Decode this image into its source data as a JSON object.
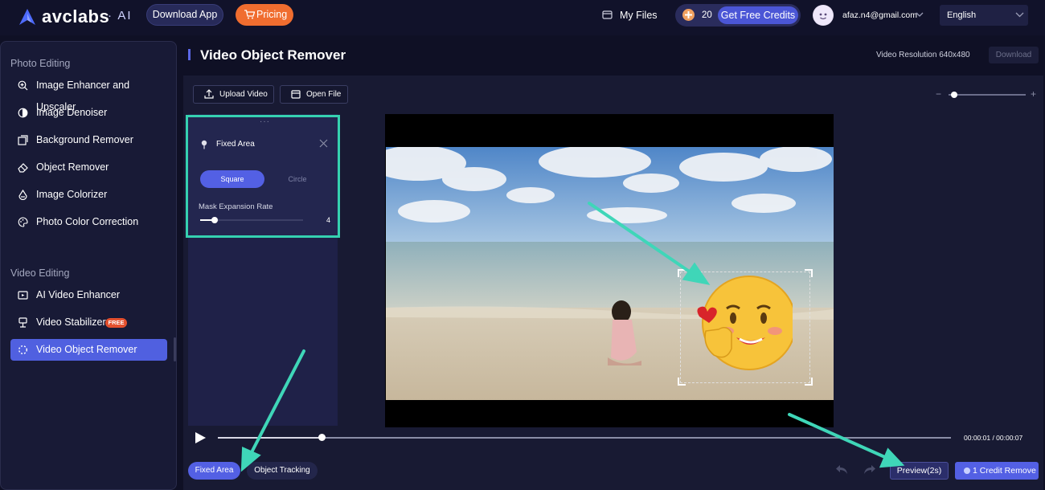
{
  "brand": {
    "name": "avclabs",
    "suffix": "· AI"
  },
  "topbar": {
    "download_app": "Download App",
    "pricing": "Pricing",
    "my_files": "My Files",
    "credits": "20",
    "get_free_credits": "Get Free Credits",
    "email": "afaz.n4@gmail.com",
    "language": "English"
  },
  "sidebar": {
    "photo_section": "Photo Editing",
    "photo_items": [
      {
        "label": "Image Enhancer and Upscaler",
        "icon": "zoom-icon"
      },
      {
        "label": "Image Denoiser",
        "icon": "denoise-icon"
      },
      {
        "label": "Background Remover",
        "icon": "background-icon"
      },
      {
        "label": "Object Remover",
        "icon": "eraser-icon"
      },
      {
        "label": "Image Colorizer",
        "icon": "colorizer-icon"
      },
      {
        "label": "Photo Color Correction",
        "icon": "palette-icon"
      }
    ],
    "video_section": "Video Editing",
    "video_items": [
      {
        "label": "AI Video Enhancer",
        "icon": "video-enhance-icon"
      },
      {
        "label": "Video Stabilizer",
        "icon": "stabilizer-icon",
        "badge": "FREE"
      },
      {
        "label": "Video Object Remover",
        "icon": "spinner-icon",
        "active": true
      }
    ]
  },
  "header": {
    "title": "Video Object Remover",
    "resolution": "Video Resolution 640x480",
    "download": "Download"
  },
  "toolbar": {
    "upload_video": "Upload Video",
    "open_file": "Open File"
  },
  "fixed_area_panel": {
    "title": "Fixed Area",
    "shape_square": "Square",
    "shape_circle": "Circle",
    "selected_shape": "Square",
    "mask_label": "Mask Expansion Rate",
    "mask_value": "4"
  },
  "player": {
    "timecode": "00:00:01 / 00:00:07",
    "progress": 0.14
  },
  "bottom": {
    "tab_fixed": "Fixed Area",
    "tab_tracking": "Object Tracking",
    "preview": "Preview(2s)",
    "credit_remove": "1 Credit Remove"
  },
  "colors": {
    "accent": "#5360e4",
    "highlight": "#35d1b0",
    "pricing": "#f06d2f"
  }
}
